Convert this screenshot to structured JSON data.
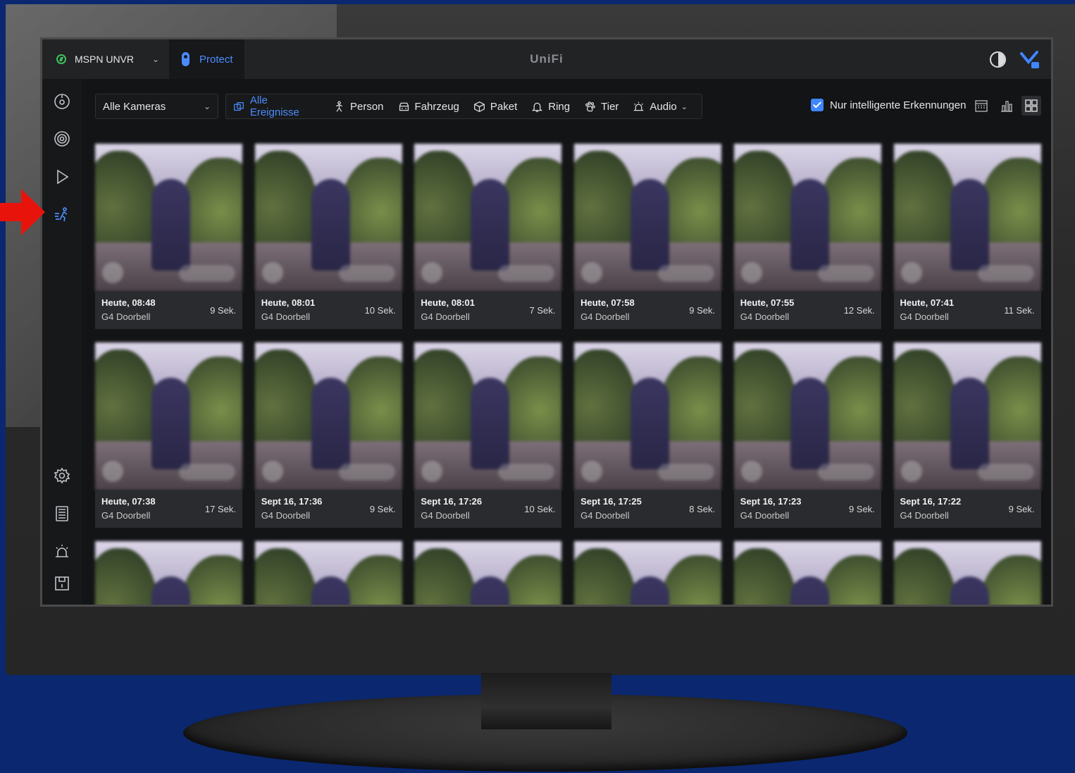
{
  "console": {
    "name": "MSPN UNVR"
  },
  "app": {
    "name": "Protect"
  },
  "logo": "UniFi",
  "camera_select": {
    "value": "Alle Kameras"
  },
  "filters": [
    {
      "label": "Alle Ereignisse",
      "icon": "all-events-icon",
      "active": true
    },
    {
      "label": "Person",
      "icon": "person-icon"
    },
    {
      "label": "Fahrzeug",
      "icon": "vehicle-icon"
    },
    {
      "label": "Paket",
      "icon": "package-icon"
    },
    {
      "label": "Ring",
      "icon": "bell-icon"
    },
    {
      "label": "Tier",
      "icon": "paw-icon"
    },
    {
      "label": "Audio",
      "icon": "alarm-icon",
      "dropdown": true
    }
  ],
  "smart_detection": {
    "label": "Nur intelligente Erkennungen",
    "checked": true
  },
  "colors": {
    "accent": "#4a8cff",
    "background": "#131416",
    "panel": "#222325",
    "card_meta": "#2a2b2e",
    "arrow": "#e8140c"
  },
  "events": [
    {
      "time": "Heute, 08:48",
      "camera": "G4 Doorbell",
      "duration": "9 Sek."
    },
    {
      "time": "Heute, 08:01",
      "camera": "G4 Doorbell",
      "duration": "10 Sek."
    },
    {
      "time": "Heute, 08:01",
      "camera": "G4 Doorbell",
      "duration": "7 Sek."
    },
    {
      "time": "Heute, 07:58",
      "camera": "G4 Doorbell",
      "duration": "9 Sek."
    },
    {
      "time": "Heute, 07:55",
      "camera": "G4 Doorbell",
      "duration": "12 Sek."
    },
    {
      "time": "Heute, 07:41",
      "camera": "G4 Doorbell",
      "duration": "11 Sek."
    },
    {
      "time": "Heute, 07:38",
      "camera": "G4 Doorbell",
      "duration": "17 Sek."
    },
    {
      "time": "Sept 16, 17:36",
      "camera": "G4 Doorbell",
      "duration": "9 Sek."
    },
    {
      "time": "Sept 16, 17:26",
      "camera": "G4 Doorbell",
      "duration": "10 Sek."
    },
    {
      "time": "Sept 16, 17:25",
      "camera": "G4 Doorbell",
      "duration": "8 Sek."
    },
    {
      "time": "Sept 16, 17:23",
      "camera": "G4 Doorbell",
      "duration": "9 Sek."
    },
    {
      "time": "Sept 16, 17:22",
      "camera": "G4 Doorbell",
      "duration": "9 Sek."
    }
  ]
}
